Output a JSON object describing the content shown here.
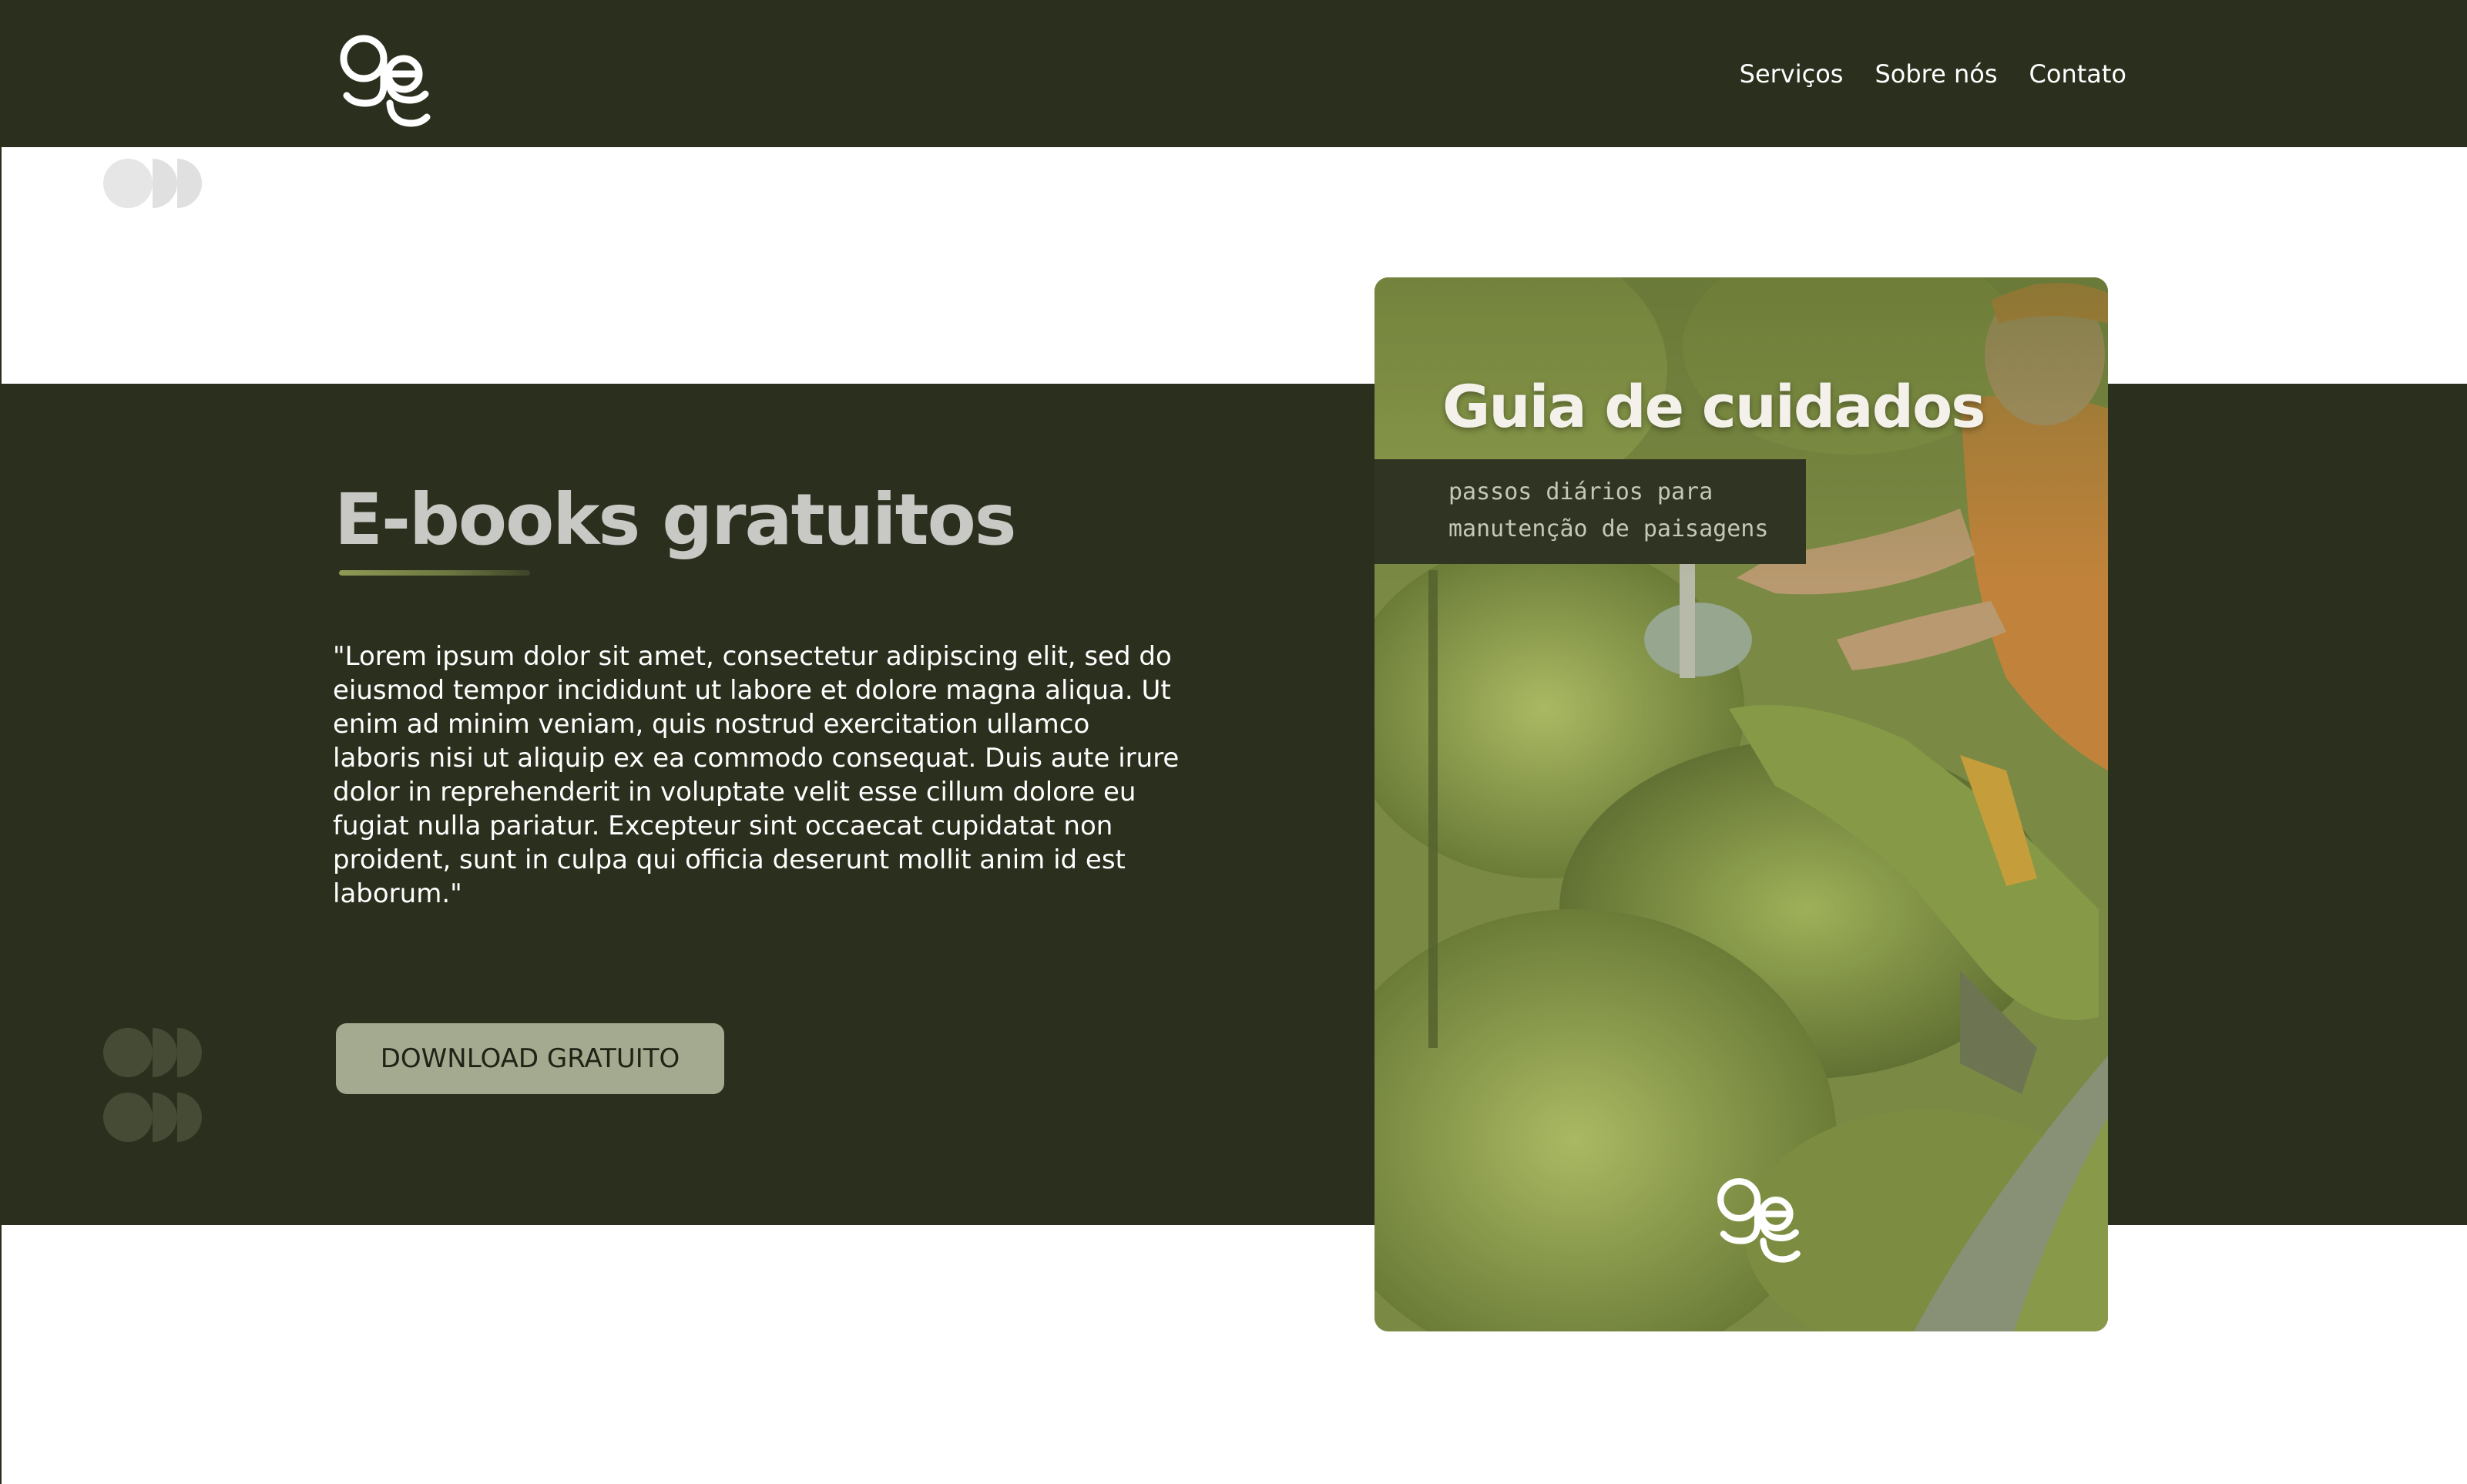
{
  "nav": {
    "items": [
      "Serviços",
      "Sobre nós",
      "Contato"
    ]
  },
  "hero": {
    "title": "E-books gratuitos",
    "body": "\"Lorem ipsum dolor sit amet, consectetur adipiscing elit, sed do eiusmod tempor incididunt ut labore et dolore magna aliqua. Ut enim ad minim veniam, quis nostrud exercitation ullamco laboris nisi ut aliquip ex ea commodo consequat. Duis aute irure dolor in reprehenderit in voluptate velit esse cillum dolore eu fugiat nulla pariatur. Excepteur sint occaecat cupidatat non proident, sunt in culpa qui officia deserunt mollit anim id est laborum.\"",
    "button_label": "DOWNLOAD GRATUITO"
  },
  "ebook": {
    "title": "Guia de cuidados",
    "subtitle_lines": [
      "passos diários para",
      "manutenção de paisagens"
    ]
  },
  "icons": {
    "logo": "gc-monogram-logo",
    "decor": "circle-dots-icon"
  },
  "colors": {
    "dark_green": "#2b2f1d",
    "button_bg": "#a4aa8f",
    "heading_gray": "#c8c8c4",
    "accent_green": "#8f9a55",
    "white": "#ffffff"
  }
}
